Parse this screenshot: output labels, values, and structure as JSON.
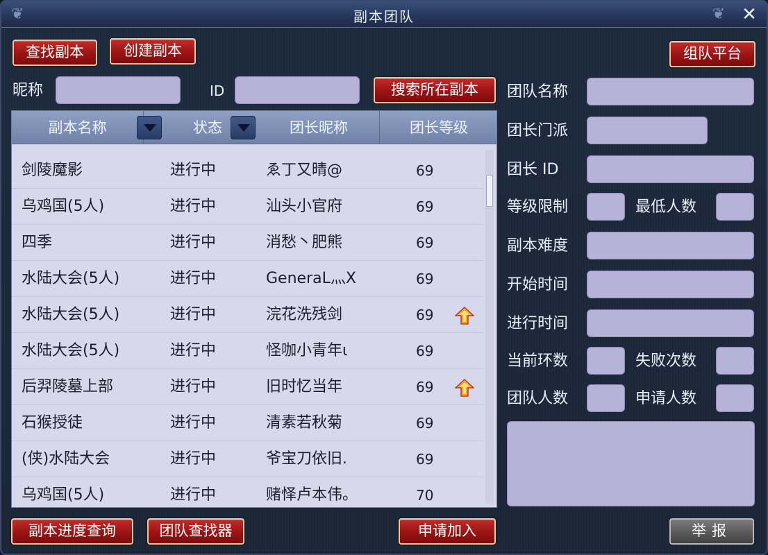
{
  "window": {
    "title": "副本团队",
    "close_symbol": "✕"
  },
  "top_buttons": {
    "find": "查找副本",
    "create": "创建副本",
    "platform": "组队平台"
  },
  "search": {
    "nickname_label": "昵称",
    "nickname_value": "",
    "id_label": "ID",
    "id_value": "",
    "search_button": "搜索所在副本"
  },
  "table": {
    "headers": [
      "副本名称",
      "状态",
      "团长昵称",
      "团长等级"
    ],
    "rows": [
      {
        "name": "剑陵魔影",
        "state": "进行中",
        "leader": "ゑ丁又晴@",
        "level": "69",
        "flag": false
      },
      {
        "name": "乌鸡国(5人)",
        "state": "进行中",
        "leader": "汕头小官府",
        "level": "69",
        "flag": false
      },
      {
        "name": "四季",
        "state": "进行中",
        "leader": "消愁丶肥熊",
        "level": "69",
        "flag": false
      },
      {
        "name": "水陆大会(5人)",
        "state": "进行中",
        "leader": "GeneraL灬X",
        "level": "69",
        "flag": false
      },
      {
        "name": "水陆大会(5人)",
        "state": "进行中",
        "leader": "浣花洗残剑",
        "level": "69",
        "flag": true
      },
      {
        "name": "水陆大会(5人)",
        "state": "进行中",
        "leader": "怪咖小青年ι",
        "level": "69",
        "flag": false
      },
      {
        "name": "后羿陵墓上部",
        "state": "进行中",
        "leader": "旧时忆当年",
        "level": "69",
        "flag": true
      },
      {
        "name": "石猴授徒",
        "state": "进行中",
        "leader": "清素若秋菊",
        "level": "69",
        "flag": false
      },
      {
        "name": "(侠)水陆大会",
        "state": "进行中",
        "leader": "爷宝刀依旧.",
        "level": "69",
        "flag": false
      },
      {
        "name": "乌鸡国(5人)",
        "state": "进行中",
        "leader": "赌怿卢本伟。",
        "level": "70",
        "flag": false
      }
    ]
  },
  "details": {
    "team_name": "团队名称",
    "leader_school": "团长门派",
    "leader_id": "团长 ID",
    "level_limit": "等级限制",
    "min_members": "最低人数",
    "difficulty": "副本难度",
    "start_time": "开始时间",
    "elapsed_time": "进行时间",
    "current_round": "当前环数",
    "fail_count": "失败次数",
    "team_size": "团队人数",
    "applicants": "申请人数"
  },
  "bottom_buttons": {
    "progress": "副本进度查询",
    "finder": "团队查找器",
    "apply": "申请加入",
    "report": "举报"
  },
  "colors": {
    "button_red": "#9a1414",
    "field_lavender": "#b6b2d8",
    "flag_orange": "#f5a623"
  },
  "icons": {
    "flag": "up-arrow-icon",
    "sort": "triangle-down-icon",
    "close": "close-icon"
  }
}
